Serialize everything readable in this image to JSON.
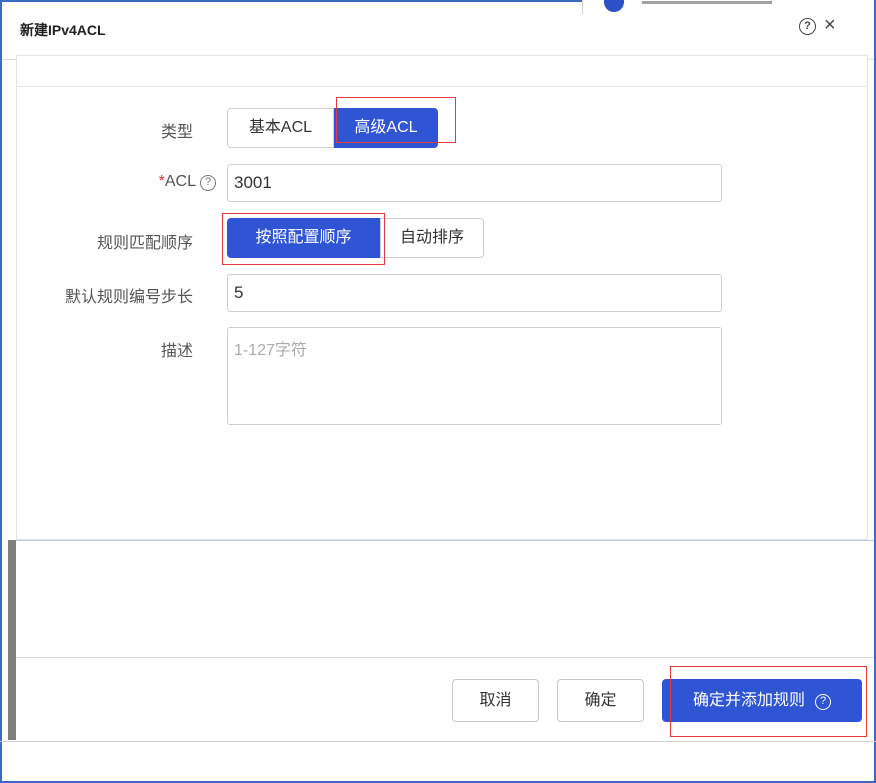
{
  "dialog": {
    "title": "新建IPv4ACL",
    "help_icon": "help-circle-icon",
    "close_icon": "close-icon",
    "close_glyph": "×",
    "help_glyph": "?"
  },
  "form": {
    "type": {
      "label": "类型",
      "options": [
        "基本ACL",
        "高级ACL"
      ],
      "selected": "高级ACL"
    },
    "acl": {
      "required_mark": "*",
      "label": "ACL",
      "help_glyph": "?",
      "value": "3001"
    },
    "match_order": {
      "label": "规则匹配顺序",
      "options": [
        "按照配置顺序",
        "自动排序"
      ],
      "selected": "按照配置顺序"
    },
    "step": {
      "label": "默认规则编号步长",
      "value": "5"
    },
    "description": {
      "label": "描述",
      "placeholder": "1-127字符",
      "value": ""
    }
  },
  "footer": {
    "cancel_label": "取消",
    "ok_label": "确定",
    "ok_add_rule_label": "确定并添加规则",
    "ok_add_rule_help_glyph": "?"
  },
  "colors": {
    "accent": "#2f55d4",
    "highlight_box": "#e23b3b",
    "required": "#e0302a"
  }
}
